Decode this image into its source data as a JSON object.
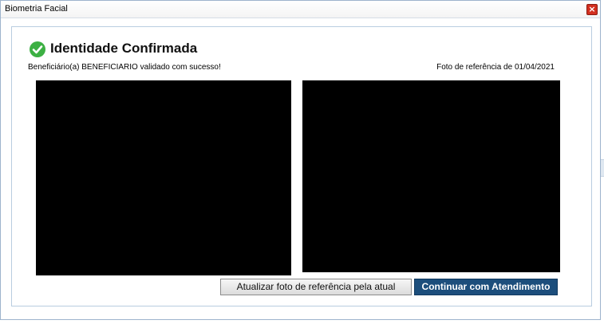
{
  "window": {
    "title": "Biometria Facial",
    "close_icon": "close-icon"
  },
  "status": {
    "icon": "check-circle-icon",
    "icon_color": "#3cb043",
    "heading": "Identidade Confirmada"
  },
  "messages": {
    "validation": "Beneficiário(a) BENEFICIARIO validado com sucesso!",
    "reference_date": "Foto de referência de 01/04/2021"
  },
  "buttons": {
    "update_reference": "Atualizar foto de referência pela atual",
    "continue": "Continuar com Atendimento",
    "continue_color": "#1c4e7c"
  }
}
